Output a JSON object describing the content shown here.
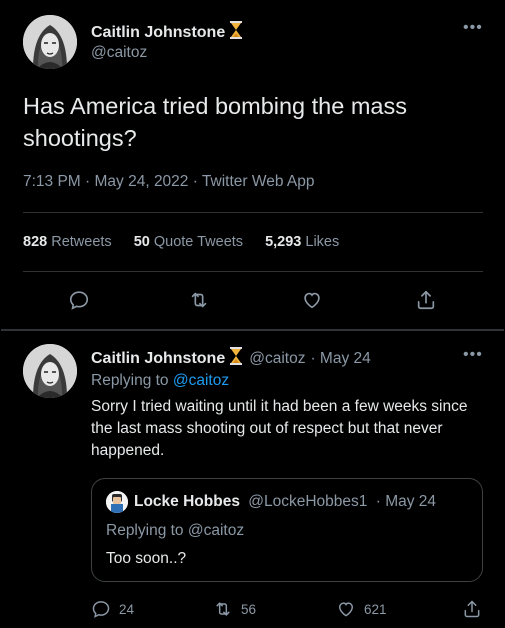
{
  "main_tweet": {
    "author_name": "Caitlin Johnstone",
    "author_handle": "@caitoz",
    "text": "Has America tried bombing the mass shootings?",
    "timestamp": "7:13 PM · May 24, 2022 · Twitter Web App",
    "stats": {
      "retweets_count": "828",
      "retweets_label": "Retweets",
      "quote_count": "50",
      "quote_label": "Quote Tweets",
      "likes_count": "5,293",
      "likes_label": "Likes"
    },
    "actions": [
      "reply-icon",
      "retweet-icon",
      "like-icon",
      "share-icon"
    ]
  },
  "reply_tweet": {
    "author_name": "Caitlin Johnstone",
    "author_handle": "@caitoz",
    "date": "· May 24",
    "replying_prefix": "Replying to",
    "replying_handle": "@caitoz",
    "text": "Sorry I tried waiting until it had been a few weeks since the last mass shooting out of respect but that never happened.",
    "quoted": {
      "author_name": "Locke Hobbes",
      "author_handle": "@LockeHobbes1",
      "date": "· May 24",
      "replying_prefix": "Replying to",
      "replying_handle": "@caitoz",
      "text": "Too soon..?"
    },
    "counts": {
      "replies": "24",
      "retweets": "56",
      "likes": "621"
    }
  },
  "colors": {
    "background": "#000000",
    "text": "#e7e9ea",
    "muted": "#8b98a5",
    "link": "#1d9bf0",
    "divider": "#2f3336"
  }
}
